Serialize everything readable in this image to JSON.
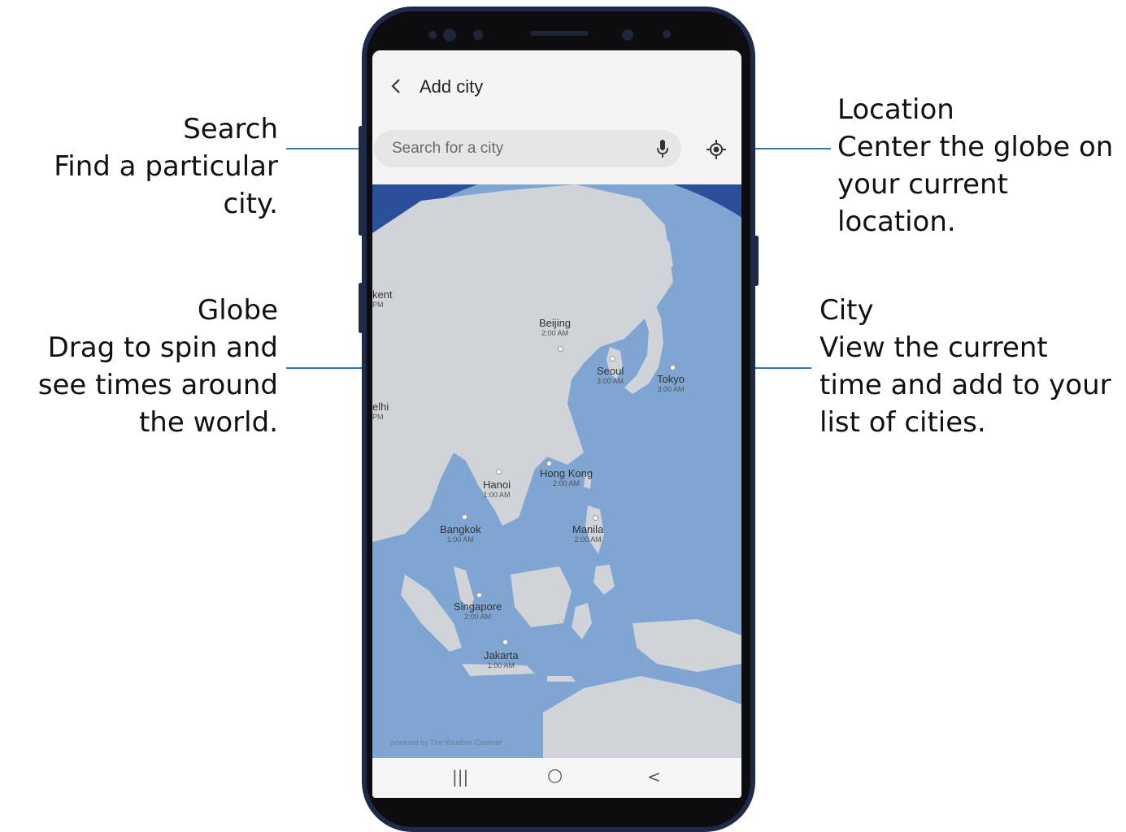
{
  "callouts": {
    "search": {
      "title": "Search",
      "desc": "Find a particular city."
    },
    "location": {
      "title": "Location",
      "desc_line1": "Center the globe on",
      "desc_line2": "your current location."
    },
    "globe": {
      "title": "Globe",
      "desc_line1": "Drag to spin and",
      "desc_line2": "see times around",
      "desc_line3": "the world."
    },
    "city": {
      "title": "City",
      "desc_line1": "View the current",
      "desc_line2": "time and add to your",
      "desc_line3": "list of cities."
    }
  },
  "app": {
    "back_icon": "back-chevron-icon",
    "title": "Add city",
    "search_placeholder": "Search for a city",
    "mic_icon": "microphone-icon",
    "location_icon": "crosshair-location-icon",
    "credit": "powered by  The Weather Channel"
  },
  "cities": [
    {
      "name": "Beijing",
      "time": "2:00 AM"
    },
    {
      "name": "Seoul",
      "time": "3:00 AM"
    },
    {
      "name": "Tokyo",
      "time": "3:00 AM"
    },
    {
      "name": "Hanoi",
      "time": "1:00 AM"
    },
    {
      "name": "Hong Kong",
      "time": "2:00 AM"
    },
    {
      "name": "Bangkok",
      "time": "1:00 AM"
    },
    {
      "name": "Manila",
      "time": "2:00 AM"
    },
    {
      "name": "Singapore",
      "time": "2:00 AM"
    },
    {
      "name": "Jakarta",
      "time": "1:00 AM"
    },
    {
      "name": "kent",
      "time": "PM"
    },
    {
      "name": "elhi",
      "time": "PM"
    }
  ],
  "navbar": {
    "recents": "|||",
    "home": "○",
    "back": "<"
  },
  "colors": {
    "ocean": "#7fa6d3",
    "land": "#d0d3d8",
    "space": "#2c4f99",
    "callout_line": "#2a7ab8",
    "phone_frame": "#1f2a4a"
  }
}
